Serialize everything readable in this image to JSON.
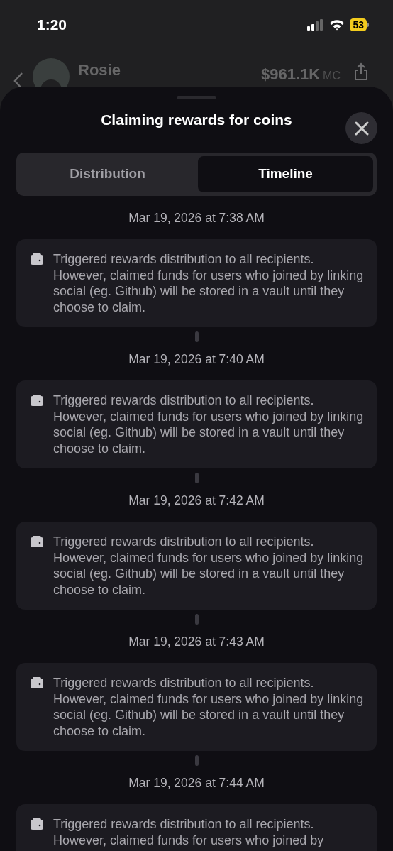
{
  "status_bar": {
    "time": "1:20",
    "battery": "53"
  },
  "header": {
    "name": "Rosie",
    "market_cap": "$961.1K",
    "market_cap_unit": "MC"
  },
  "sheet": {
    "title": "Claiming rewards for coins",
    "tabs": [
      {
        "label": "Distribution",
        "selected": false
      },
      {
        "label": "Timeline",
        "selected": true
      }
    ],
    "timeline": [
      {
        "date": "Mar 19, 2026 at 7:38 AM",
        "text": "Triggered rewards distribution to all recipients. However, claimed funds for users who joined by linking social (eg. Github) will be stored in a vault until they choose to claim."
      },
      {
        "date": "Mar 19, 2026 at 7:40 AM",
        "text": "Triggered rewards distribution to all recipients. However, claimed funds for users who joined by linking social (eg. Github) will be stored in a vault until they choose to claim."
      },
      {
        "date": "Mar 19, 2026 at 7:42 AM",
        "text": "Triggered rewards distribution to all recipients. However, claimed funds for users who joined by linking social (eg. Github) will be stored in a vault until they choose to claim."
      },
      {
        "date": "Mar 19, 2026 at 7:43 AM",
        "text": "Triggered rewards distribution to all recipients. However, claimed funds for users who joined by linking social (eg. Github) will be stored in a vault until they choose to claim."
      },
      {
        "date": "Mar 19, 2026 at 7:44 AM",
        "text": "Triggered rewards distribution to all recipients. However, claimed funds for users who joined by"
      }
    ]
  }
}
